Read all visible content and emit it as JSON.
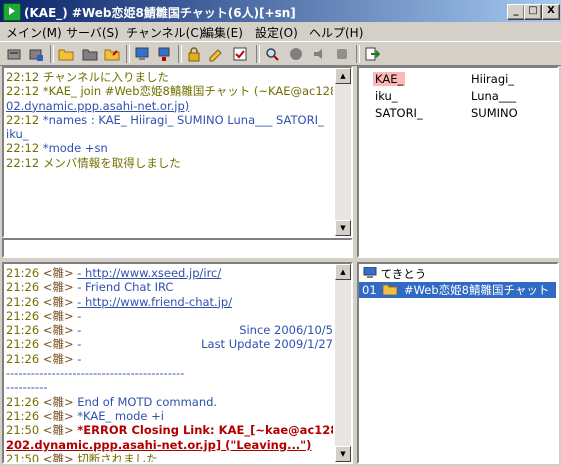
{
  "window": {
    "title": "(KAE_) #Web恋姫8鯖雛国チャット(6人)[+sn]",
    "minimize": "_",
    "maximize": "□",
    "close": "X"
  },
  "menu": [
    "メイン(M)",
    "サーバ(S)",
    "チャンネル(C)",
    "編集(E)",
    "設定(O)",
    "ヘルプ(H)"
  ],
  "toolbar": {
    "icons": [
      "server-connect-icon",
      "server-disconnect-icon",
      "folder-icon",
      "folder-closed-icon",
      "channel-join-icon",
      "channel-part-icon",
      "computer-icon",
      "monitor-icon",
      "lock-icon",
      "edit-icon",
      "checklist-icon",
      "search-icon",
      "brush-icon",
      "speaker-icon",
      "stop-icon",
      "exit-icon"
    ]
  },
  "channel_log": [
    {
      "time": "22:12",
      "text": "チャンネルに入りました",
      "style": "olive"
    },
    {
      "time": "22:12",
      "text": "*KAE_ join #Web恋姫8鯖雛国チャット (~KAE@ac1282",
      "style": "olive"
    },
    {
      "time": "",
      "text": "02.dynamic.ppp.asahi-net.or.jp)",
      "style": "olive-link"
    },
    {
      "time": "22:12",
      "text": "*names : KAE_ Hiiragi_ SUMINO Luna___ SATORI_",
      "style": "blue"
    },
    {
      "time": "",
      "text": "iku_",
      "style": "blue"
    },
    {
      "time": "22:12",
      "text": "*mode +sn",
      "style": "blue"
    },
    {
      "time": "22:12",
      "text": "メンバ情報を取得しました",
      "style": "olive"
    }
  ],
  "input": {
    "value": ""
  },
  "users": [
    {
      "name": "KAE_",
      "selected": true
    },
    {
      "name": "Hiiragi_",
      "selected": false
    },
    {
      "name": "iku_",
      "selected": false
    },
    {
      "name": "Luna___",
      "selected": false
    },
    {
      "name": "SATORI_",
      "selected": false
    },
    {
      "name": "SUMINO",
      "selected": false
    }
  ],
  "server_log": [
    {
      "time": "21:26",
      "nick": "<雛>",
      "text": "-   http://www.xseed.jp/irc/",
      "style": "link"
    },
    {
      "time": "21:26",
      "nick": "<雛>",
      "text": "-   Friend Chat IRC",
      "style": "blue"
    },
    {
      "time": "21:26",
      "nick": "<雛>",
      "text": "-   http://www.friend-chat.jp/",
      "style": "link"
    },
    {
      "time": "21:26",
      "nick": "<雛>",
      "text": "-",
      "style": "blue"
    },
    {
      "time": "21:26",
      "nick": "<雛>",
      "text": "-",
      "right": "Since 2006/10/5",
      "style": "blue"
    },
    {
      "time": "21:26",
      "nick": "<雛>",
      "text": "-",
      "right": "Last Update 2009/1/27",
      "style": "blue"
    },
    {
      "time": "21:26",
      "nick": "<雛>",
      "text": "-",
      "style": "blue"
    },
    {
      "time": "",
      "nick": "",
      "text": "-------------------------------------------",
      "style": "blue"
    },
    {
      "time": "",
      "nick": "",
      "text": "----------",
      "style": "blue"
    },
    {
      "time": "21:26",
      "nick": "<雛>",
      "text": "End of MOTD command.",
      "style": "blue"
    },
    {
      "time": "21:26",
      "nick": "<雛>",
      "text": "*KAE_ mode +i",
      "style": "blue"
    },
    {
      "time": "21:50",
      "nick": "<雛>",
      "text": "*ERROR Closing Link: KAE_[~kae@ac128",
      "style": "red"
    },
    {
      "time": "",
      "nick": "",
      "text": "202.dynamic.ppp.asahi-net.or.jp] (\"Leaving...\")",
      "style": "redlink"
    },
    {
      "time": "21:50",
      "nick": "<雛>",
      "text": "切断されました",
      "style": "olive"
    }
  ],
  "tree": {
    "root": "てきとう",
    "channel_index": "01",
    "channel": "#Web恋姫8鯖雛国チャット"
  }
}
